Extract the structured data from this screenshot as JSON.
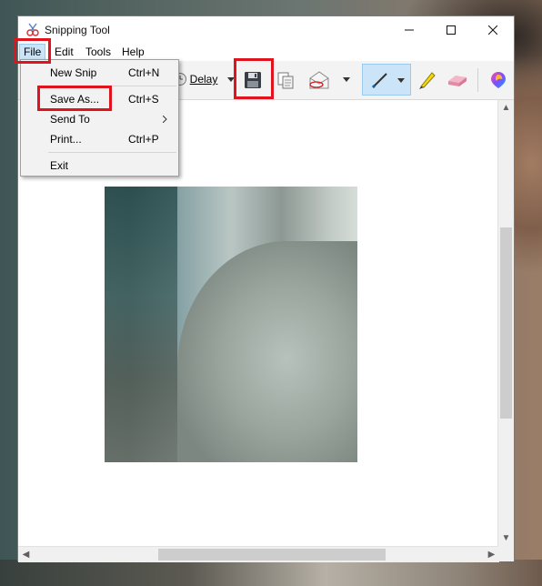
{
  "window": {
    "title": "Snipping Tool"
  },
  "menubar": {
    "file": "File",
    "edit": "Edit",
    "tools": "Tools",
    "help": "Help"
  },
  "toolbar": {
    "delay_label": "Delay"
  },
  "file_menu": {
    "items": [
      {
        "label": "New Snip",
        "shortcut": "Ctrl+N"
      },
      {
        "label": "Save As...",
        "shortcut": "Ctrl+S"
      },
      {
        "label": "Send To",
        "shortcut": ""
      },
      {
        "label": "Print...",
        "shortcut": "Ctrl+P"
      },
      {
        "label": "Exit",
        "shortcut": ""
      }
    ]
  },
  "colors": {
    "highlight": "#e0141e",
    "menu_selected": "#cce4f7",
    "pen_selected": "#cce4f7"
  }
}
